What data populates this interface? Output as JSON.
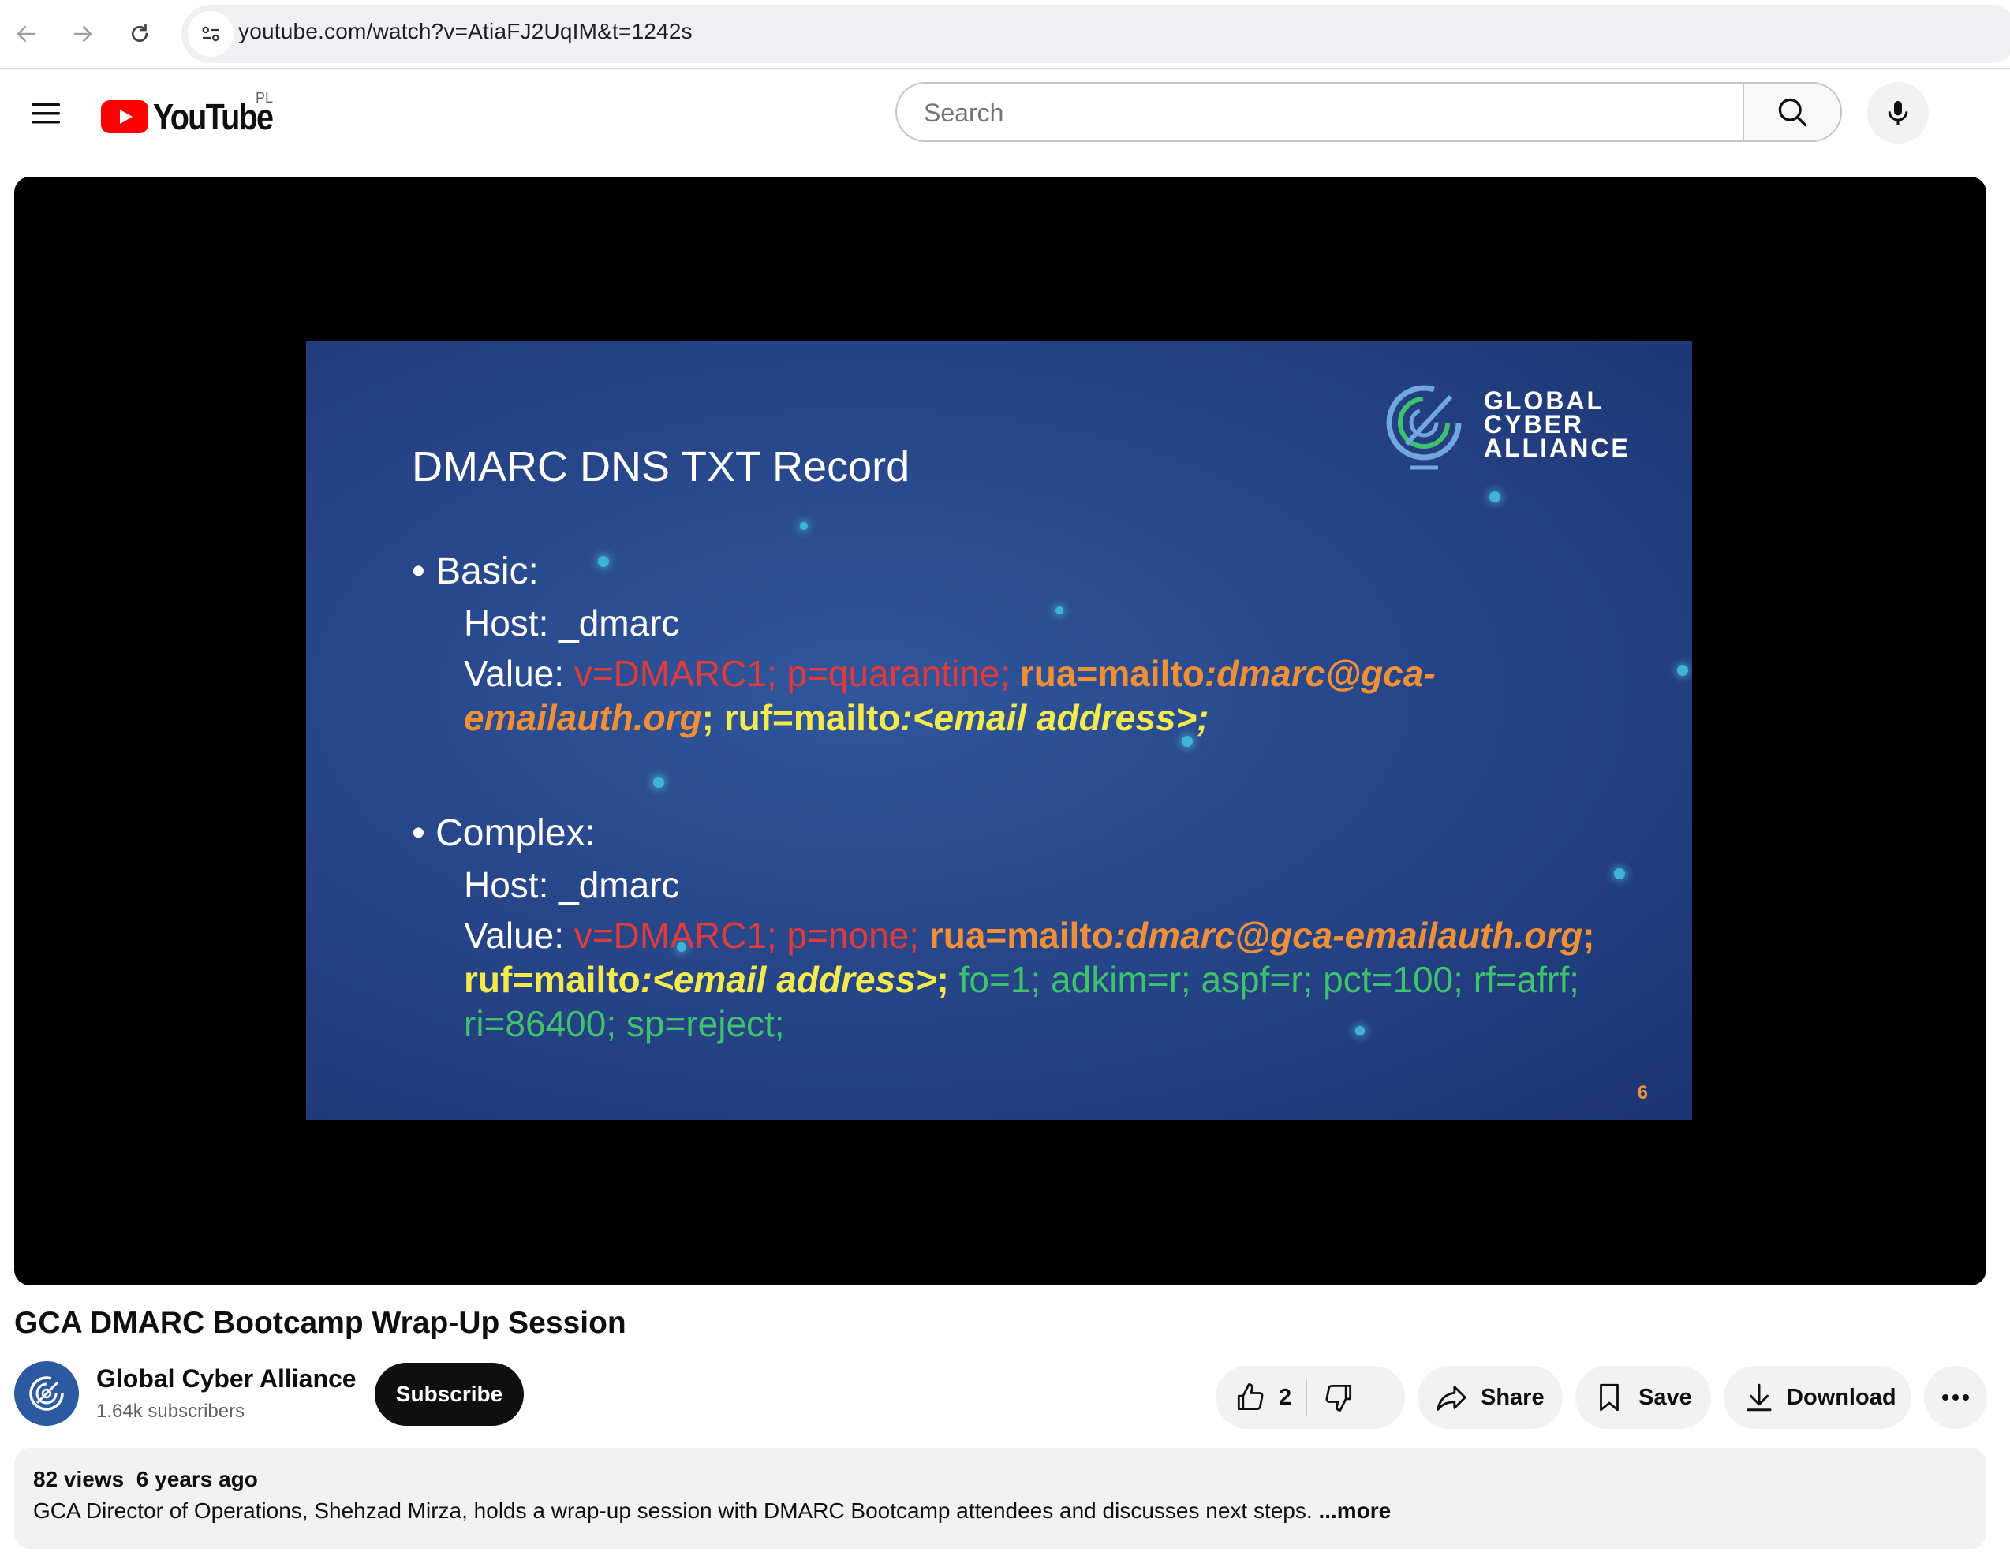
{
  "browser": {
    "url": "youtube.com/watch?v=AtiaFJ2UqIM&t=1242s",
    "icons": [
      "back-arrow-icon",
      "forward-arrow-icon",
      "reload-icon",
      "site-settings-icon"
    ]
  },
  "header": {
    "logo_text": "YouTube",
    "region": "PL",
    "search_placeholder": "Search",
    "brand_color": "#ff0000"
  },
  "slide": {
    "title": "DMARC DNS TXT Record",
    "basic": {
      "label": "Basic:",
      "host": "Host: _dmarc",
      "value_label": "Value:",
      "v": "v=DMARC1;",
      "p": "p=quarantine;",
      "rua_key": "rua=mailto",
      "rua_val_1": ":dmarc@gca-",
      "rua_val_2": "emailauth.org",
      "sep": ";",
      "ruf_key": "ruf=mailto",
      "ruf_val": ":<email address>;"
    },
    "complex": {
      "label": "Complex:",
      "host": "Host: _dmarc",
      "value_label": "Value:",
      "v": "v=DMARC1;",
      "p": "p=none;",
      "rua_key": "rua=mailto",
      "rua_val": ":dmarc@gca-emailauth.org",
      "sep": ";",
      "ruf_key": "ruf=mailto",
      "ruf_val": ":<email address>",
      "ruf_end": ";",
      "tags_1": "fo=1; adkim=r; aspf=r; pct=100; rf=afrf;",
      "tags_2": "ri=86400; sp=reject;"
    },
    "logo_line1": "GLOBAL",
    "logo_line2": "CYBER",
    "logo_line3": "ALLIANCE",
    "page_number": "6"
  },
  "video": {
    "title": "GCA DMARC Bootcamp Wrap-Up Session",
    "channel_name": "Global Cyber Alliance",
    "subscribers": "1.64k subscribers",
    "subscribe_label": "Subscribe",
    "like_count": "2",
    "share_label": "Share",
    "save_label": "Save",
    "download_label": "Download",
    "views": "82 views",
    "age": "6 years ago",
    "description": "GCA Director of Operations, Shehzad Mirza, holds a wrap-up session with DMARC Bootcamp attendees and discusses next steps.",
    "more_label": "...more"
  }
}
